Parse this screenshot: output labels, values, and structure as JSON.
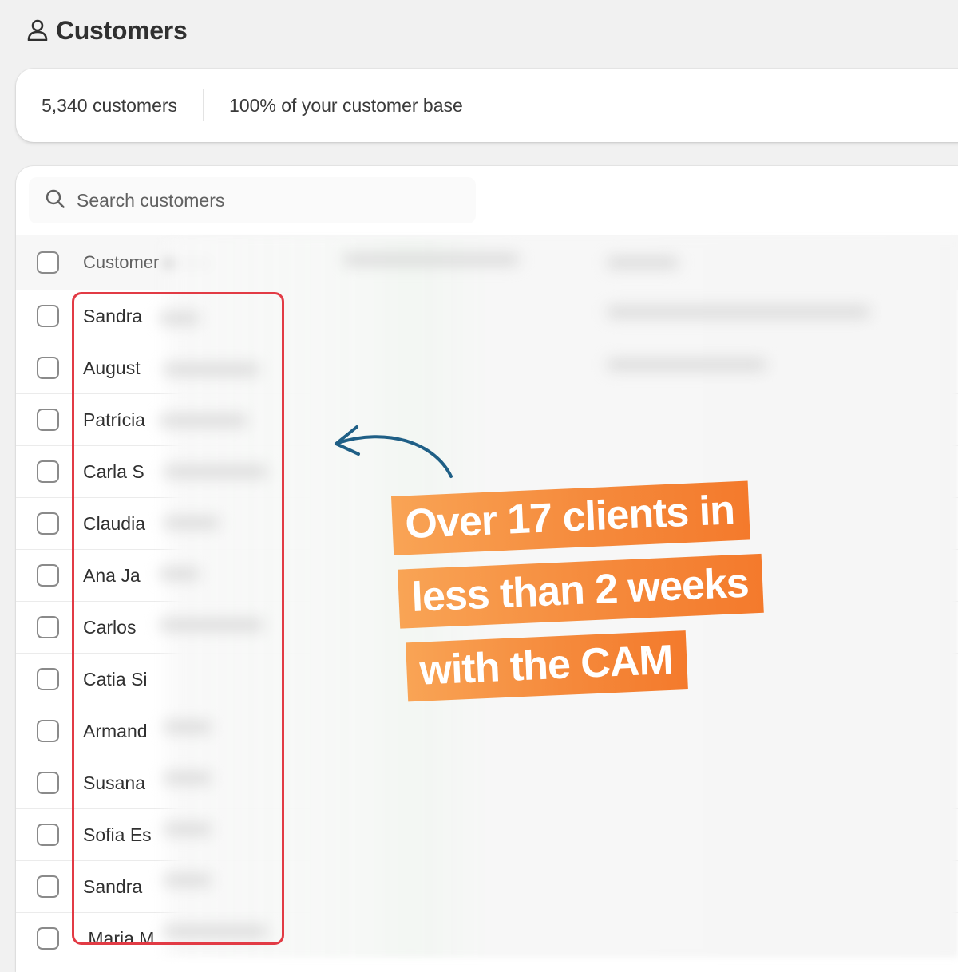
{
  "header": {
    "title": "Customers",
    "icon": "person-icon"
  },
  "stats": {
    "count": "5,340 customers",
    "share": "100% of your customer base"
  },
  "search": {
    "placeholder": "Search customers",
    "icon": "search-icon"
  },
  "table": {
    "column_header": "Customer",
    "rows": [
      {
        "name": "Sandra"
      },
      {
        "name": "August"
      },
      {
        "name": "Patrícia"
      },
      {
        "name": "Carla S"
      },
      {
        "name": "Claudia"
      },
      {
        "name": "Ana Ja"
      },
      {
        "name": "Carlos"
      },
      {
        "name": "Catia Si"
      },
      {
        "name": "Armand"
      },
      {
        "name": "Susana"
      },
      {
        "name": "Sofia Es"
      },
      {
        "name": "Sandra"
      },
      {
        "name": ".Maria M"
      }
    ]
  },
  "annotation": {
    "lines": [
      "Over 17 clients in",
      "less than 2 weeks",
      "with the CAM"
    ],
    "highlight_color": "#e23b45",
    "callout_color": "#f58a3c",
    "arrow_color": "#1f5f86"
  }
}
